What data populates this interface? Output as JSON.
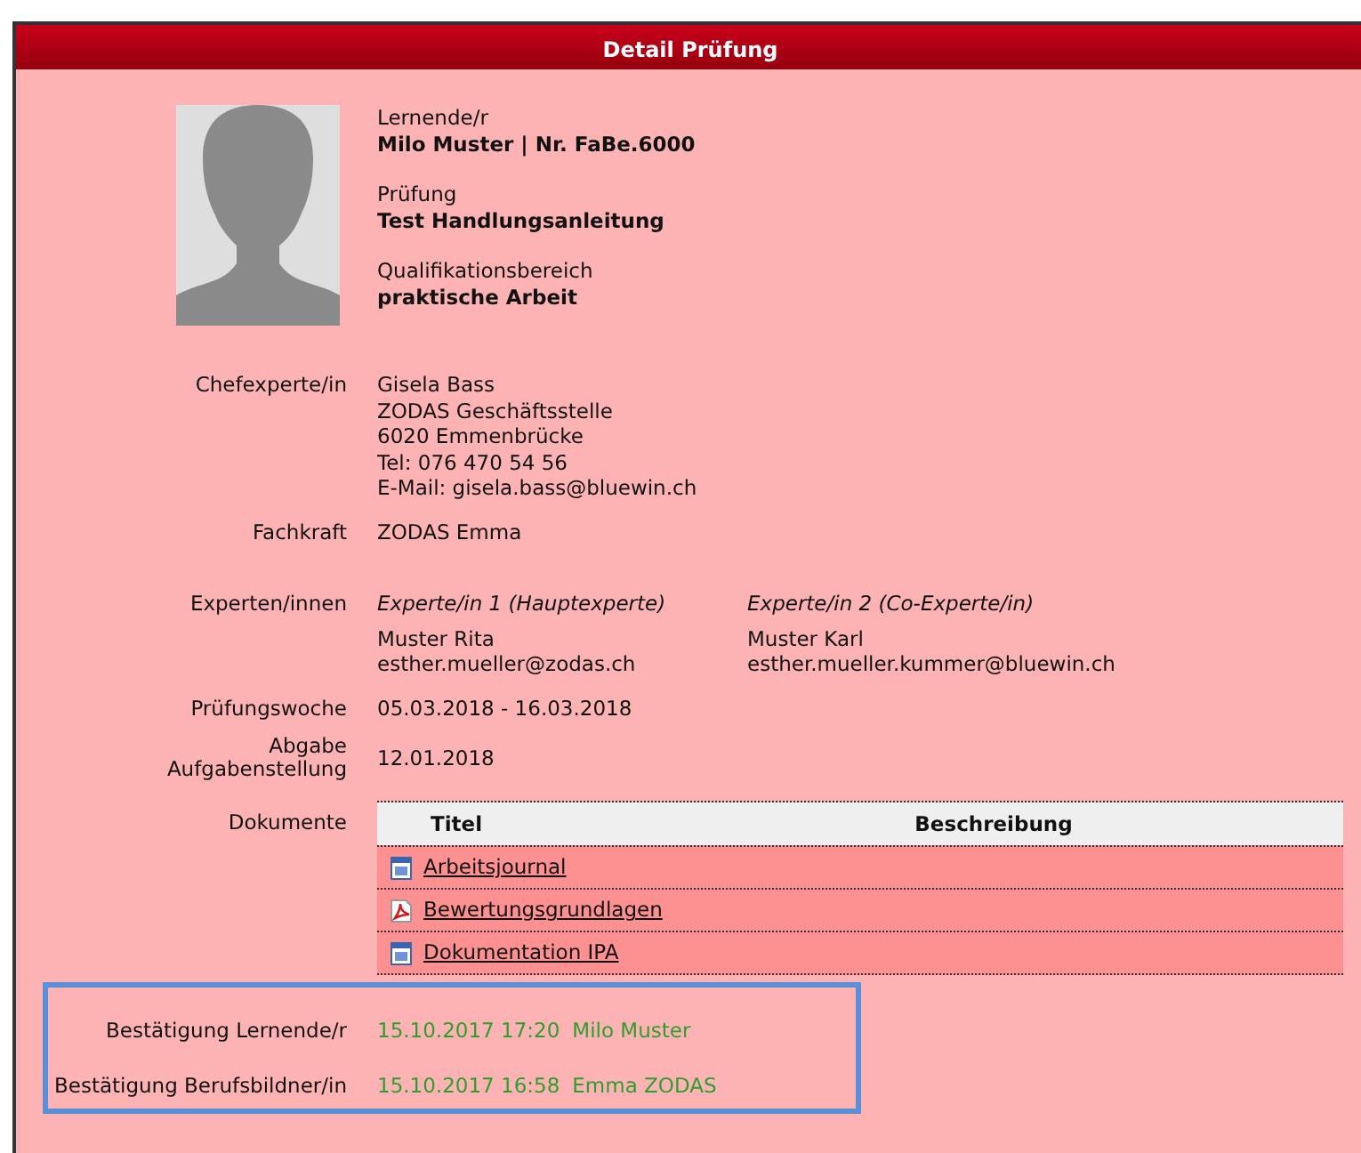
{
  "panel": {
    "title": "Detail Prüfung"
  },
  "profile": [
    {
      "label": "Lernende/r",
      "value": "Milo Muster | Nr. FaBe.6000"
    },
    {
      "label": "Prüfung",
      "value": "Test Handlungsanleitung"
    },
    {
      "label": "Qualifikationsbereich",
      "value": "praktische Arbeit"
    }
  ],
  "chefexperte": {
    "label": "Chefexperte/in",
    "lines": [
      "Gisela Bass",
      "ZODAS Geschäftsstelle",
      "6020 Emmenbrücke",
      "Tel: 076 470 54 56",
      "E-Mail: gisela.bass@bluewin.ch"
    ]
  },
  "fachkraft": {
    "label": "Fachkraft",
    "value": "ZODAS Emma"
  },
  "experten": {
    "label": "Experten/innen",
    "items": [
      {
        "role": "Experte/in 1 (Hauptexperte)",
        "name": "Muster Rita",
        "email": "esther.mueller@zodas.ch"
      },
      {
        "role": "Experte/in 2 (Co-Experte/in)",
        "name": "Muster Karl",
        "email": "esther.mueller.kummer@bluewin.ch"
      }
    ]
  },
  "pruefungswoche": {
    "label": "Prüfungswoche",
    "value": "05.03.2018 - 16.03.2018"
  },
  "abgabe": {
    "label": "Abgabe Aufgabenstellung",
    "value": "12.01.2018"
  },
  "dokumente": {
    "label": "Dokumente",
    "columns": [
      "Titel",
      "Beschreibung"
    ],
    "rows": [
      {
        "kind": "word",
        "title": "Arbeitsjournal"
      },
      {
        "kind": "pdf",
        "title": "Bewertungsgrundlagen"
      },
      {
        "kind": "word",
        "title": "Dokumentation IPA"
      }
    ]
  },
  "bestaetigungen": [
    {
      "label": "Bestätigung Lernende/r",
      "date": "15.10.2017 17:20",
      "name": "Milo Muster"
    },
    {
      "label": "Bestätigung Berufsbildner/in",
      "date": "15.10.2017 16:58",
      "name": "Emma ZODAS"
    }
  ]
}
